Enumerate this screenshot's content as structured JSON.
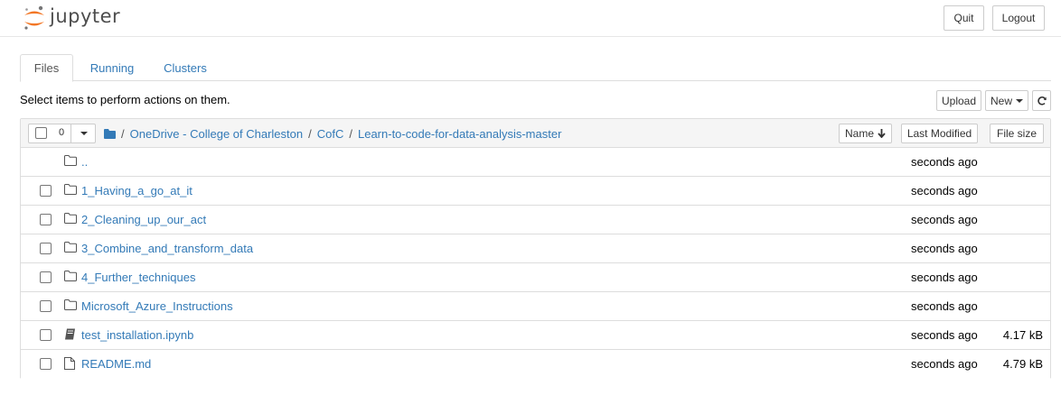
{
  "header": {
    "logo_text": "jupyter",
    "quit_label": "Quit",
    "logout_label": "Logout"
  },
  "tabs": [
    {
      "label": "Files",
      "active": true
    },
    {
      "label": "Running",
      "active": false
    },
    {
      "label": "Clusters",
      "active": false
    }
  ],
  "hint": "Select items to perform actions on them.",
  "toolbar": {
    "upload_label": "Upload",
    "new_label": "New"
  },
  "list_header": {
    "selected_count": "0",
    "breadcrumb": [
      {
        "label": "/",
        "type": "sep"
      },
      {
        "label": "OneDrive - College of Charleston",
        "type": "link"
      },
      {
        "label": "/",
        "type": "sep"
      },
      {
        "label": "CofC",
        "type": "link"
      },
      {
        "label": "/",
        "type": "sep"
      },
      {
        "label": "Learn-to-code-for-data-analysis-master",
        "type": "link"
      }
    ],
    "sort_name_label": "Name",
    "sort_modified_label": "Last Modified",
    "sort_size_label": "File size"
  },
  "rows": [
    {
      "name": "..",
      "type": "parent",
      "modified": "seconds ago",
      "size": ""
    },
    {
      "name": "1_Having_a_go_at_it",
      "type": "folder",
      "modified": "seconds ago",
      "size": ""
    },
    {
      "name": "2_Cleaning_up_our_act",
      "type": "folder",
      "modified": "seconds ago",
      "size": ""
    },
    {
      "name": "3_Combine_and_transform_data",
      "type": "folder",
      "modified": "seconds ago",
      "size": ""
    },
    {
      "name": "4_Further_techniques",
      "type": "folder",
      "modified": "seconds ago",
      "size": ""
    },
    {
      "name": "Microsoft_Azure_Instructions",
      "type": "folder",
      "modified": "seconds ago",
      "size": ""
    },
    {
      "name": "test_installation.ipynb",
      "type": "notebook",
      "modified": "seconds ago",
      "size": "4.17 kB"
    },
    {
      "name": "README.md",
      "type": "file",
      "modified": "seconds ago",
      "size": "4.79 kB"
    }
  ],
  "colors": {
    "link": "#337ab7",
    "logo_orange": "#f37726",
    "border": "#dddddd"
  }
}
